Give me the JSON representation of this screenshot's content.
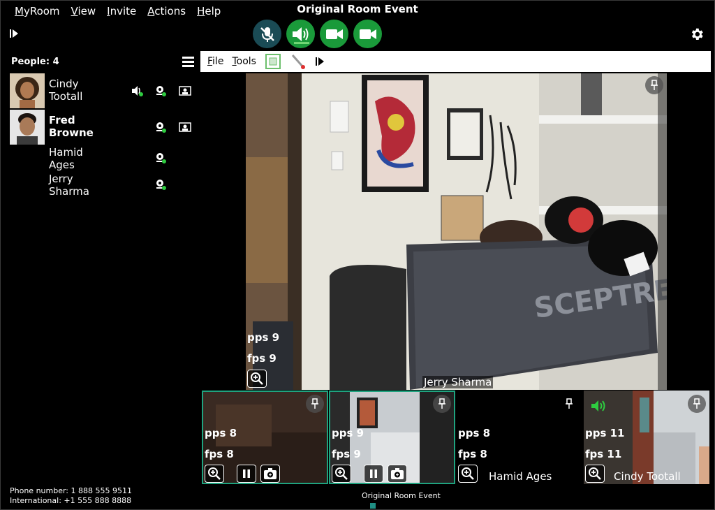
{
  "menu": {
    "items": [
      "MyRoom",
      "View",
      "Invite",
      "Actions",
      "Help"
    ]
  },
  "window": {
    "title": "Original Room Event"
  },
  "toolbar": {
    "buttons": [
      "mic-muted-icon",
      "speaker-icon",
      "camera-icon",
      "camera-icon"
    ]
  },
  "sidebar": {
    "people_header": "People: 4",
    "people": [
      {
        "first": "Cindy",
        "last": "Tootall",
        "bold": false
      },
      {
        "first": "Fred",
        "last": "Browne",
        "bold": true
      },
      {
        "first": "Hamid",
        "last": "Ages",
        "bold": false
      },
      {
        "first": "Jerry",
        "last": "Sharma",
        "bold": false
      }
    ],
    "phone_number": "Phone number: 1 888 555 9511",
    "international": "International:  +1 555 888 8888"
  },
  "content_menu": {
    "file": "File",
    "tools": "Tools"
  },
  "main_video": {
    "pps": "pps 9",
    "fps": "fps 9",
    "name": "Jerry Sharma"
  },
  "thumbnails": [
    {
      "pps": "pps 8",
      "fps": "fps 8",
      "name": ""
    },
    {
      "pps": "pps 9",
      "fps": "fps 9",
      "name": ""
    },
    {
      "pps": "pps 8",
      "fps": "fps 8",
      "name": "Hamid Ages"
    },
    {
      "pps": "pps 11",
      "fps": "fps 11",
      "name": "Cindy Tootall"
    }
  ],
  "footer": {
    "title": "Original Room Event"
  },
  "colors": {
    "accent_green": "#1a9a3a",
    "selected_border": "#1fa37f",
    "presence_green": "#2ecc40"
  }
}
